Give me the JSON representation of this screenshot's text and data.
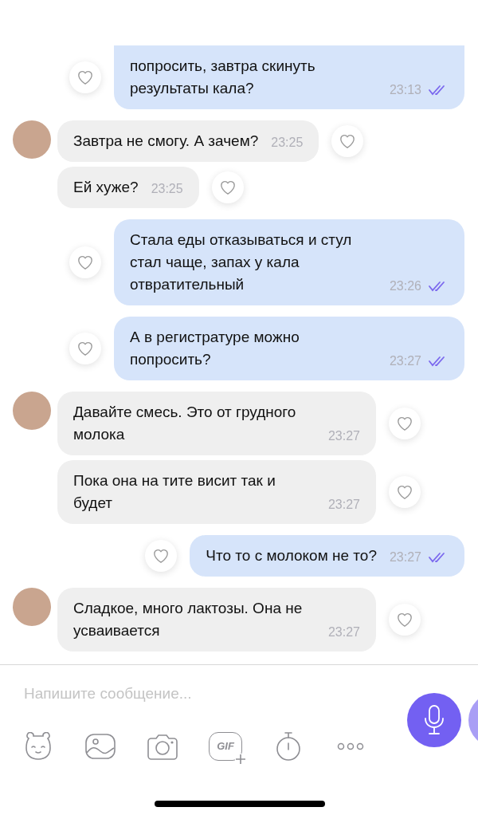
{
  "messages": [
    {
      "kind": "outgoing",
      "text": "попросить, завтра скинуть результаты кала?",
      "time": "23:13",
      "read": true,
      "cut_top": true
    },
    {
      "kind": "incoming",
      "text": "Завтра не смогу. А зачем?",
      "time": "23:25",
      "avatar": true
    },
    {
      "kind": "incoming",
      "text": "Ей хуже?",
      "time": "23:25",
      "avatar": false
    },
    {
      "kind": "outgoing",
      "text": "Стала еды отказываться и стул стал чаще, запах у кала отвратительный",
      "time": "23:26",
      "read": true,
      "cut_top": false
    },
    {
      "kind": "outgoing",
      "text": "А в регистратуре можно попросить?",
      "time": "23:27",
      "read": true,
      "cut_top": false
    },
    {
      "kind": "incoming",
      "text": "Давайте смесь. Это от грудного молока",
      "time": "23:27",
      "avatar": true
    },
    {
      "kind": "incoming",
      "text": "Пока она на тите висит так и будет",
      "time": "23:27",
      "avatar": false
    },
    {
      "kind": "outgoing",
      "text": "Что то с молоком не то?",
      "time": "23:27",
      "read": true,
      "cut_top": false
    },
    {
      "kind": "incoming",
      "text": "Сладкое, много лактозы. Она не усваивается",
      "time": "23:27",
      "avatar": true
    }
  ],
  "composer": {
    "placeholder": "Напишите сообщение..."
  },
  "toolbar": {
    "gif_label": "GIF"
  }
}
